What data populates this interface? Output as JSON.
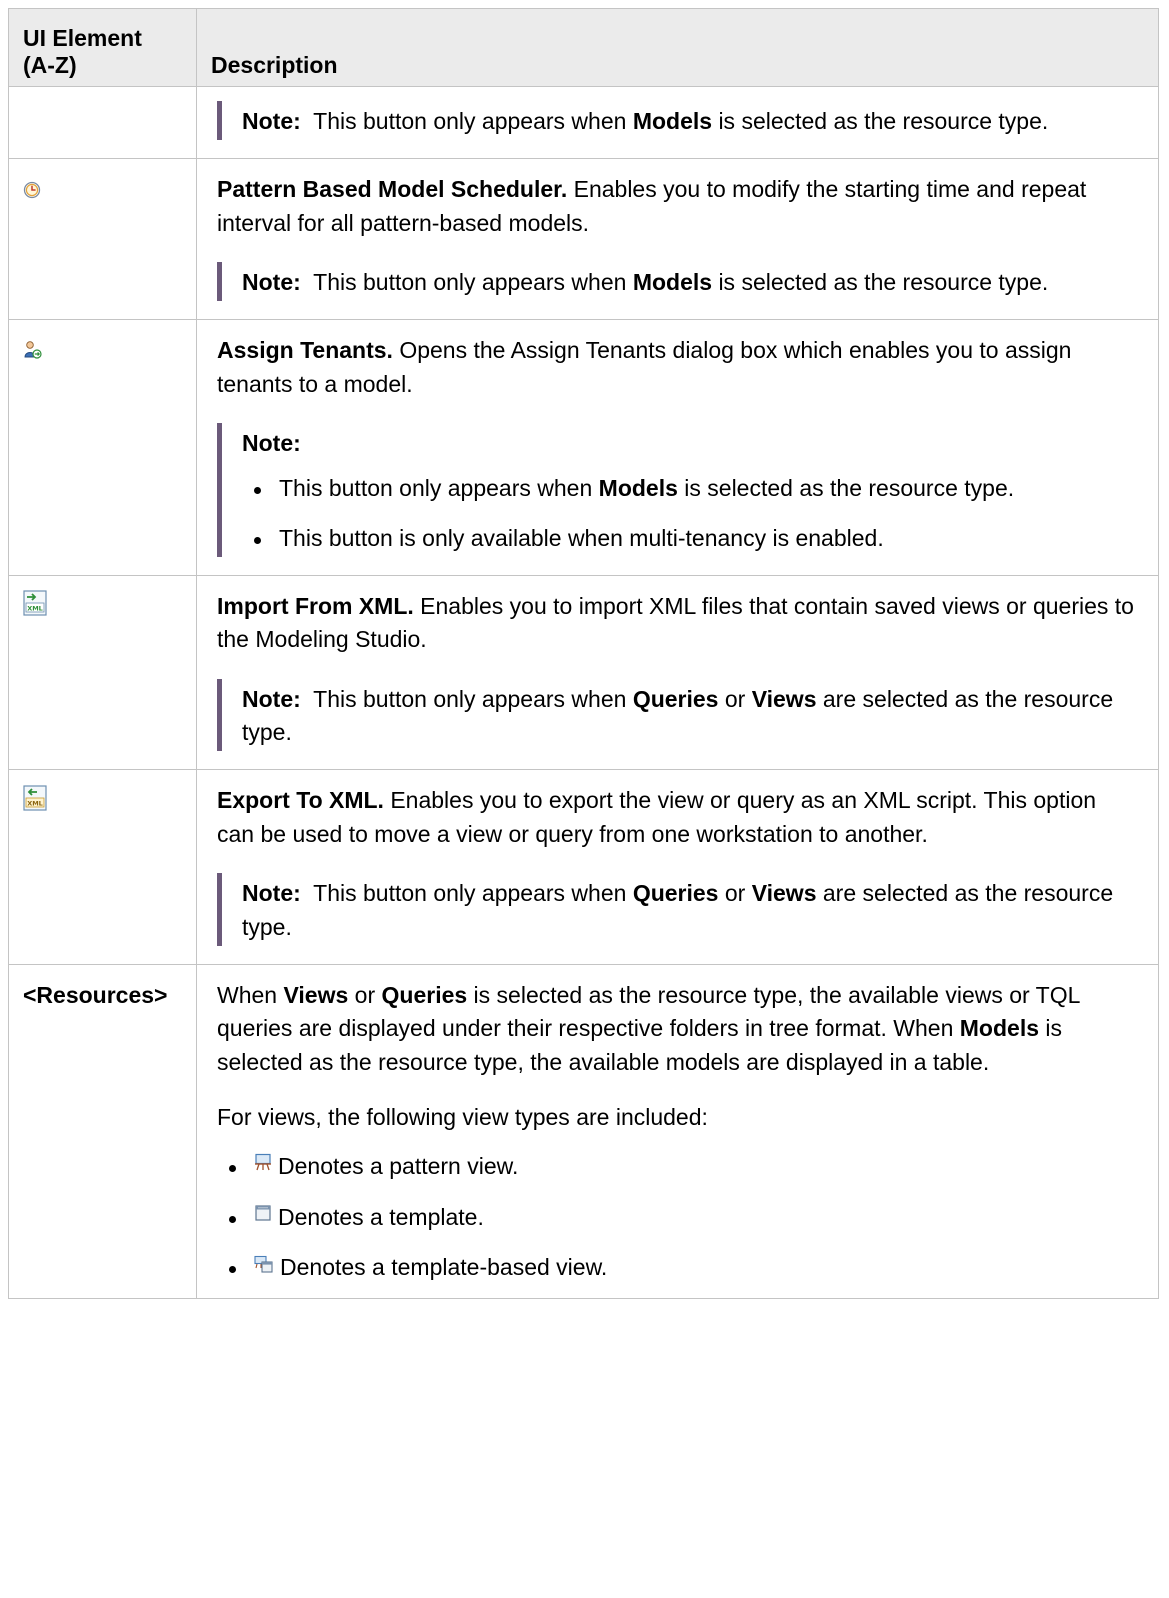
{
  "table": {
    "headers": {
      "col1_line1": "UI Element",
      "col1_line2": "(A-Z)",
      "col2": "Description"
    },
    "common": {
      "note_label": "Note:",
      "appears_pre": "This button only appears when",
      "models": "Models",
      "queries": "Queries",
      "or": "or",
      "views": "Views",
      "is_selected_as": "is selected as the resource type.",
      "are_selected_as": "are selected as the resource type."
    },
    "row_carryover": {},
    "row_pattern_scheduler": {
      "icon": "clock-icon",
      "title": "Pattern Based Model Scheduler.",
      "desc": " Enables you to modify the starting time and repeat interval for all pattern-based models."
    },
    "row_assign_tenants": {
      "icon": "assign-tenants-icon",
      "title": "Assign Tenants.",
      "desc": " Opens the Assign Tenants dialog box which enables you to assign tenants to a model.",
      "bullet2": "This button is only available when multi-tenancy is enabled."
    },
    "row_import_xml": {
      "icon": "import-xml-icon",
      "title": "Import From XML.",
      "desc": " Enables you to import XML files that contain saved views or queries to the Modeling Studio."
    },
    "row_export_xml": {
      "icon": "export-xml-icon",
      "title": "Export To XML.",
      "desc": " Enables you to export the view or query as an XML script. This option can be used to move a view or query from one workstation to another."
    },
    "row_resources": {
      "element": "<Resources>",
      "p1_when": "When ",
      "p1_views": "Views",
      "p1_or": " or ",
      "p1_queries": "Queries",
      "p1_mid": " is selected as the resource type, the available views or TQL queries are displayed under their respective folders in tree format. When ",
      "p1_models": "Models",
      "p1_end": " is selected as the resource type, the available models are displayed in a table.",
      "p2": "For views, the following view types are included:",
      "types": [
        {
          "icon": "pattern-view-icon",
          "text": "Denotes a pattern view."
        },
        {
          "icon": "template-icon",
          "text": "Denotes a template."
        },
        {
          "icon": "template-based-view-icon",
          "text": "Denotes a template-based view."
        }
      ]
    }
  }
}
